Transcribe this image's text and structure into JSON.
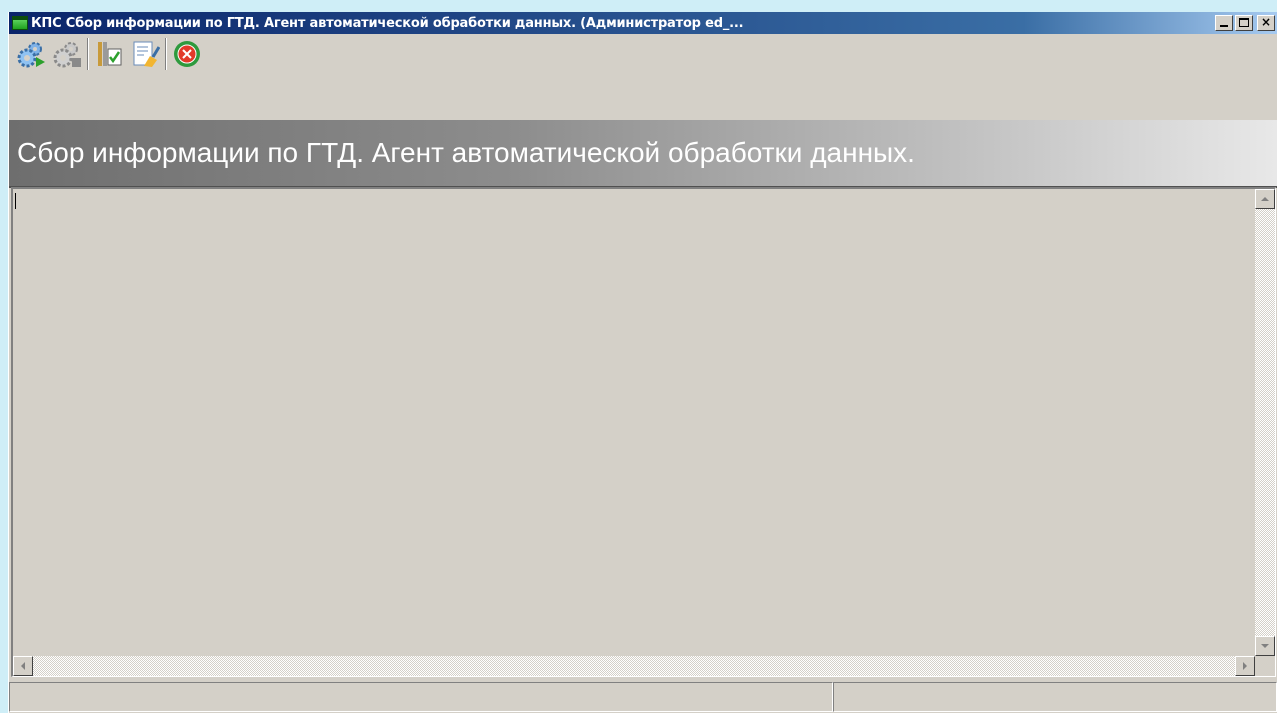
{
  "window": {
    "title": "КПС Сбор информации по ГТД. Агент автоматической обработки данных. (Администратор ed_...",
    "controls": {
      "minimize": "minimize",
      "maximize": "maximize",
      "close": "×"
    }
  },
  "toolbar": {
    "buttons": [
      {
        "name": "start-processing-button",
        "icon": "gears-run-icon"
      },
      {
        "name": "stop-processing-button",
        "icon": "gears-stop-icon"
      },
      {
        "name": "settings-button",
        "icon": "tools-check-icon"
      },
      {
        "name": "clear-log-button",
        "icon": "document-brush-icon"
      },
      {
        "name": "exit-button",
        "icon": "close-circle-icon"
      }
    ]
  },
  "banner": {
    "text": "Сбор информации по ГТД. Агент автоматической обработки данных."
  },
  "log": {
    "content": ""
  },
  "statusbar": {
    "left": "",
    "right": ""
  },
  "colors": {
    "titlebar_start": "#0a246a",
    "titlebar_end": "#a6caf0",
    "face": "#d4d0c8",
    "desktop": "#cfeef7",
    "banner_text": "#ffffff"
  }
}
